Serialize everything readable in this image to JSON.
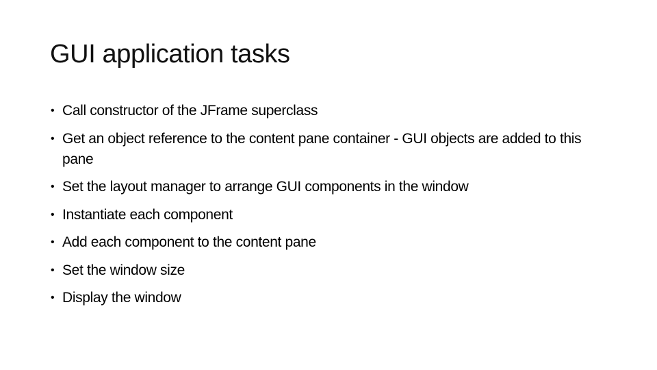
{
  "slide": {
    "title": "GUI application tasks",
    "bullet_glyph": "•",
    "bullets": [
      {
        "text": "Call constructor of the JFrame superclass"
      },
      {
        "text": "Get an object reference to the content pane container - GUI objects are added to this pane"
      },
      {
        "text": "Set the layout manager to arrange GUI components in the window"
      },
      {
        "text": "Instantiate each component"
      },
      {
        "text": "Add each component to the content pane"
      },
      {
        "text": "Set the window size"
      },
      {
        "text": "Display the window"
      }
    ]
  }
}
